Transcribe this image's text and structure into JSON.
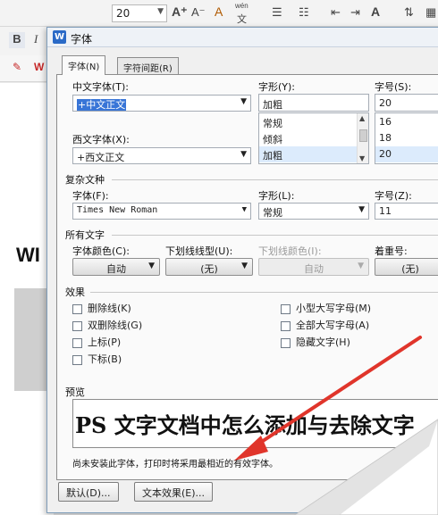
{
  "toolbar": {
    "font_size": "20",
    "bold": "B",
    "italic": "I",
    "grow_font": "A⁺",
    "shrink_font": "A⁻",
    "clear_format": "A",
    "phonetic_top": "wén",
    "phonetic_bottom": "文"
  },
  "document": {
    "visible_text": "WI"
  },
  "dialog": {
    "title": "字体",
    "tabs": [
      {
        "label": "字体(N)"
      },
      {
        "label": "字符间距(R)"
      }
    ],
    "chinese_font": {
      "label": "中文字体(T):",
      "value": "+中文正文"
    },
    "western_font": {
      "label": "西文字体(X):",
      "value": "+西文正文"
    },
    "font_style": {
      "label": "字形(Y):",
      "value": "加粗",
      "options": [
        "常规",
        "倾斜",
        "加粗"
      ]
    },
    "font_size": {
      "label": "字号(S):",
      "value": "20",
      "options": [
        "16",
        "18",
        "20"
      ]
    },
    "complex_section": "复杂文种",
    "complex_font": {
      "label": "字体(F):",
      "value": "Times New Roman"
    },
    "complex_style": {
      "label": "字形(L):",
      "value": "常规"
    },
    "complex_size": {
      "label": "字号(Z):",
      "value": "11"
    },
    "all_text_section": "所有文字",
    "font_color": {
      "label": "字体颜色(C):",
      "value": "自动"
    },
    "underline_style": {
      "label": "下划线线型(U):",
      "value": "(无)"
    },
    "underline_color": {
      "label": "下划线颜色(I):",
      "value": "自动"
    },
    "emphasis_mark": {
      "label": "着重号:",
      "value": "(无)"
    },
    "effects_section": "效果",
    "effects_left": [
      {
        "label": "删除线(K)"
      },
      {
        "label": "双删除线(G)"
      },
      {
        "label": "上标(P)"
      },
      {
        "label": "下标(B)"
      }
    ],
    "effects_right": [
      {
        "label": "小型大写字母(M)"
      },
      {
        "label": "全部大写字母(A)"
      },
      {
        "label": "隐藏文字(H)"
      }
    ],
    "preview_section": "预览",
    "preview_text": "PS 文字文档中怎么添加与去除文字",
    "note": "尚未安装此字体，打印时将采用最相近的有效字体。",
    "default_button": "默认(D)...",
    "text_effect_button": "文本效果(E)..."
  },
  "colors": {
    "accent_arrow": "#e0352b",
    "selection": "#3875d7",
    "list_highlight": "#dcebfc"
  }
}
